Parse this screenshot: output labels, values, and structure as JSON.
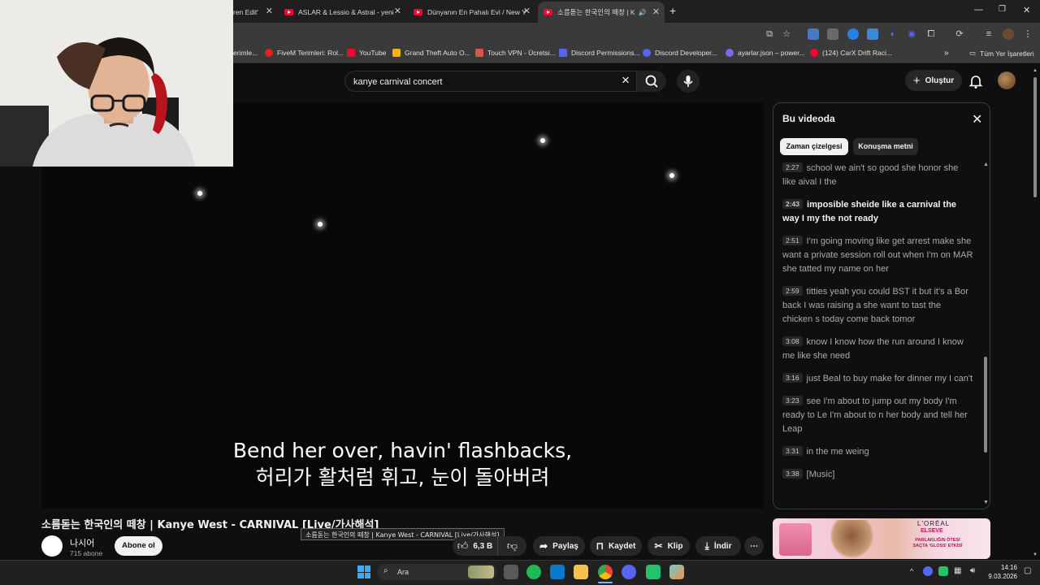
{
  "browser": {
    "tabs": [
      {
        "label": "ren Edit'"
      },
      {
        "label": "ASLAR & Lessio & Astral - yeni"
      },
      {
        "label": "Dünyanın En Pahalı Evi / New Y"
      },
      {
        "label": "소름돋는 한국인의 떼창 | K"
      }
    ],
    "new_tab": "+",
    "window_controls": {
      "minimize": "—",
      "maximize": "❐",
      "close": "✕"
    },
    "bookmarks": [
      {
        "label": "erimle...",
        "color": "#444444"
      },
      {
        "label": "FiveM Terimleri: Rol...",
        "color": "#e62117"
      },
      {
        "label": "YouTube",
        "color": "#ff0033"
      },
      {
        "label": "Grand Theft Auto O...",
        "color": "#fcaf17"
      },
      {
        "label": "Touch VPN - Ücretsi...",
        "color": "#d9534f"
      },
      {
        "label": "Discord Permissions...",
        "color": "#5865f2"
      },
      {
        "label": "Discord Developer...",
        "color": "#5865f2"
      },
      {
        "label": "ayarlar.json – power...",
        "color": "#7b68ee"
      },
      {
        "label": "(124) CarX Drift Raci...",
        "color": "#ff0033"
      }
    ],
    "bookmarks_more": "»",
    "all_bookmarks": "Tüm Yer İşaretleri"
  },
  "youtube": {
    "search": {
      "value": "kanye carnival concert",
      "placeholder": "Ara"
    },
    "create_label": "Oluştur",
    "subtitles": {
      "line1": "Bend her over, havin' flashbacks,",
      "line2": "허리가 활처럼 휘고, 눈이 돌아버려"
    },
    "video_title": "소름돋는 한국인의 떼창 | Kanye West - CARNIVAL [Live/가사해석]",
    "tooltip": "소름돋는 한국인의 떼창 | Kanye West - CARNIVAL [Live/가사해석]",
    "channel": {
      "name": "나시어",
      "subscribers": "715 abone",
      "subscribe_label": "Abone ol"
    },
    "actions": {
      "likes": "6,3 B",
      "share": "Paylaş",
      "save": "Kaydet",
      "clip": "Klip",
      "download": "İndir",
      "more": "⋯"
    },
    "panel": {
      "title": "Bu videoda",
      "tabs": [
        {
          "label": "Zaman çizelgesi",
          "selected": true
        },
        {
          "label": "Konuşma metni",
          "selected": false
        }
      ],
      "segments": [
        {
          "time": "2:27",
          "text": "school we ain't so good she honor she like aival I the",
          "active": false
        },
        {
          "time": "2:43",
          "text": "imposible sheide like a carnival the way I my the not ready",
          "active": true
        },
        {
          "time": "2:51",
          "text": "I'm going moving like get arrest make she want a private session roll out when I'm on MAR she tatted my name on her",
          "active": false
        },
        {
          "time": "2:59",
          "text": "titties yeah you could BST it but it's a Bor back I was raising a she want to tast the chicken s today come back tomor",
          "active": false
        },
        {
          "time": "3:08",
          "text": "know I know how the run around I know me like she need",
          "active": false
        },
        {
          "time": "3:16",
          "text": "just Beal to buy make for dinner my I can't",
          "active": false
        },
        {
          "time": "3:23",
          "text": "see I'm about to jump out my body I'm ready to Le I'm about to n her body and tell her Leap",
          "active": false
        },
        {
          "time": "3:31",
          "text": "in the me weing",
          "active": false
        },
        {
          "time": "3:38",
          "text": "[Music]",
          "active": false
        }
      ]
    },
    "ad": {
      "brand": "L'ORÉAL",
      "product": "ELSEVE",
      "tagline": "PARLAKLIĞIN ÖTESİ SAÇTA 'GLOSS' ETKİSİ"
    }
  },
  "taskbar": {
    "search_label": "Ara",
    "time": "14:16",
    "date": "9.03.2026"
  },
  "colors": {
    "youtube_red": "#ff0033",
    "background": "#0f0f0f",
    "panel_border": "#3a3a3a"
  }
}
